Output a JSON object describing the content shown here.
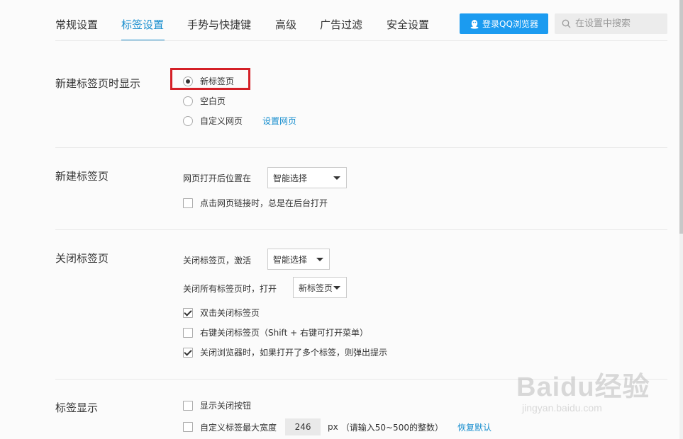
{
  "nav": {
    "tabs": [
      {
        "label": "常规设置"
      },
      {
        "label": "标签设置"
      },
      {
        "label": "手势与快捷键"
      },
      {
        "label": "高级"
      },
      {
        "label": "广告过滤"
      },
      {
        "label": "安全设置"
      }
    ],
    "active_tab": "标签设置",
    "login_button": "登录QQ浏览器",
    "search_placeholder": "在设置中搜索",
    "accent_color": "#1a8fcf"
  },
  "sections": {
    "startup": {
      "title": "新建标签页时显示",
      "options": [
        {
          "label": "新标签页",
          "selected": true
        },
        {
          "label": "空白页",
          "selected": false
        },
        {
          "label": "自定义网页",
          "selected": false
        }
      ],
      "set_page_link": "设置网页"
    },
    "new_tab": {
      "title": "新建标签页",
      "position_label": "网页打开后位置在",
      "position_value": "智能选择",
      "background_open": {
        "label": "点击网页链接时，总是在后台打开",
        "checked": false
      }
    },
    "close_tab": {
      "title": "关闭标签页",
      "activate_label": "关闭标签页，激活",
      "activate_value": "智能选择",
      "close_all_label": "关闭所有标签页时，打开",
      "close_all_value": "新标签页",
      "options": [
        {
          "label": "双击关闭标签页",
          "checked": true
        },
        {
          "label": "右键关闭标签页（Shift + 右键可打开菜单）",
          "checked": false
        },
        {
          "label": "关闭浏览器时，如果打开了多个标签，则弹出提示",
          "checked": true
        }
      ]
    },
    "tab_display": {
      "title": "标签显示",
      "show_close": {
        "label": "显示关闭按钮",
        "checked": false
      },
      "max_width": {
        "label": "自定义标签最大宽度",
        "checked": false,
        "value": "246",
        "unit": "px",
        "hint": "（请输入50~500的整数）",
        "reset_link": "恢复默认"
      }
    }
  },
  "watermark": {
    "logo": "Baidu经验",
    "url": "jingyan.baidu.com"
  },
  "highlight_color": "#d42027"
}
